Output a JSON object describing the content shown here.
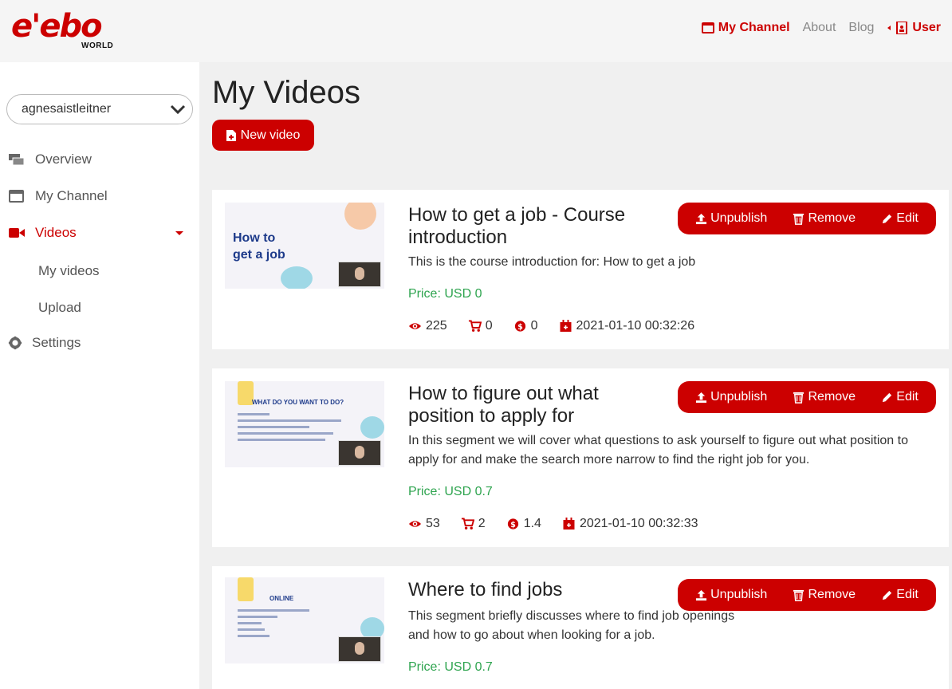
{
  "brand": {
    "logo_text": "e'ebo",
    "logo_sub": "WORLD"
  },
  "topnav": {
    "my_channel": "My Channel",
    "about": "About",
    "blog": "Blog",
    "user": "User"
  },
  "sidebar": {
    "account": "agnesaistleitner",
    "items": [
      {
        "label": "Overview",
        "icon": "overview-icon"
      },
      {
        "label": "My Channel",
        "icon": "window-icon"
      },
      {
        "label": "Videos",
        "icon": "video-camera-icon",
        "active": true
      },
      {
        "label": "My videos"
      },
      {
        "label": "Upload"
      },
      {
        "label": "Settings",
        "icon": "gear-icon"
      }
    ]
  },
  "main": {
    "title": "My Videos",
    "new_video_label": "New video"
  },
  "actions": {
    "unpublish": "Unpublish",
    "remove": "Remove",
    "edit": "Edit"
  },
  "videos": [
    {
      "title": "How to get a job - Course introduction",
      "description": "This is the course introduction for: How to get a job",
      "price": "Price: USD 0",
      "views": "225",
      "purchases": "0",
      "earnings": "0",
      "date": "2021-01-10 00:32:26",
      "thumb_title": "How to\nget a job"
    },
    {
      "title": "How to figure out what position to apply for",
      "description": "In this segment we will cover what questions to ask yourself to figure out what position to apply for and make the search more narrow to find the right job for you.",
      "price": "Price: USD 0.7",
      "views": "53",
      "purchases": "2",
      "earnings": "1.4",
      "date": "2021-01-10 00:32:33",
      "thumb_title": "WHAT DO YOU WANT TO DO?"
    },
    {
      "title": "Where to find jobs",
      "description": "This segment briefly discusses where to find job openings and how to go about when looking for a job.",
      "price": "Price: USD 0.7",
      "thumb_title": "ONLINE"
    }
  ],
  "colors": {
    "accent": "#cc0000",
    "price": "#2ea44f"
  }
}
